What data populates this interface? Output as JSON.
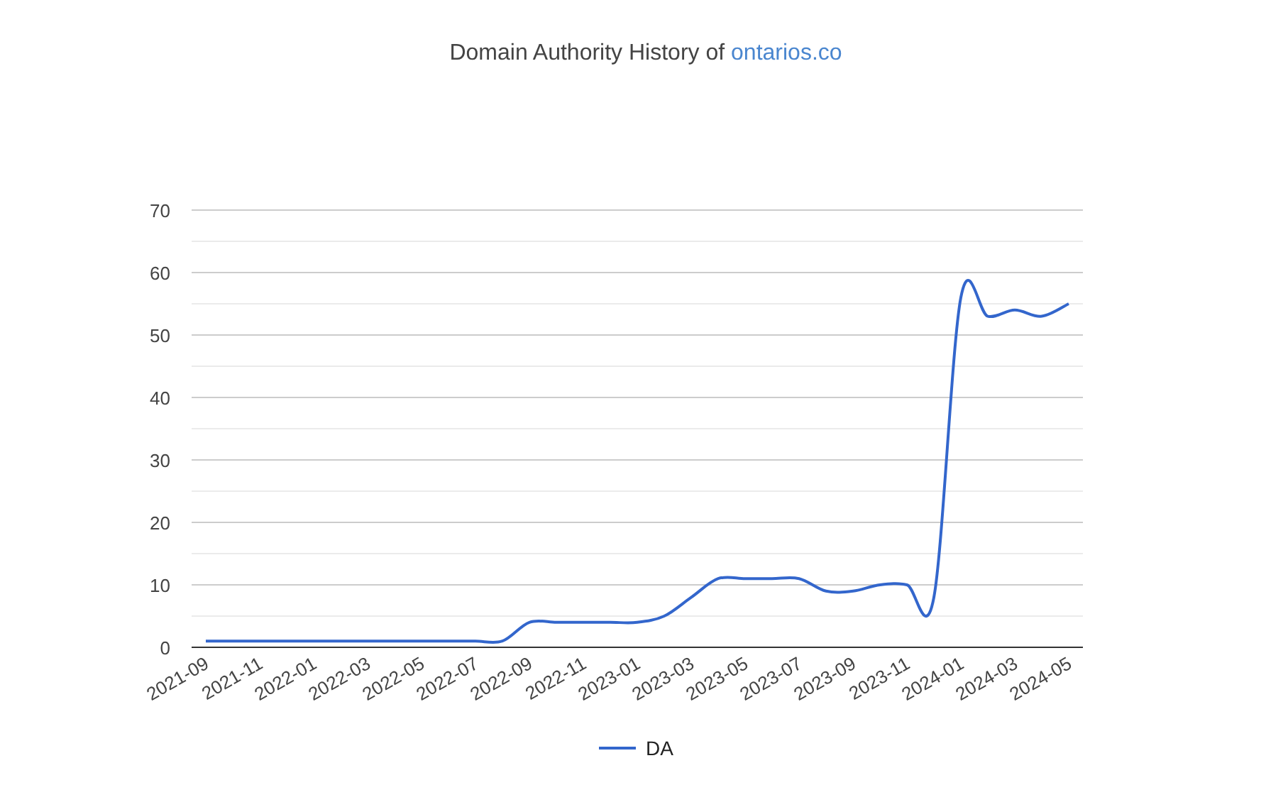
{
  "title": {
    "text": "Domain Authority History of",
    "link": "ontarios.co"
  },
  "chart_data": {
    "type": "line",
    "grid": true,
    "categories": [
      "2021-09",
      null,
      "2021-11",
      null,
      "2022-01",
      null,
      "2022-03",
      null,
      "2022-05",
      null,
      "2022-07",
      null,
      "2022-09",
      null,
      "2022-11",
      null,
      "2023-01",
      null,
      "2023-03",
      null,
      "2023-05",
      null,
      "2023-07",
      null,
      "2023-09",
      null,
      "2023-11",
      null,
      "2024-01",
      null,
      "2024-03",
      null,
      "2024-05"
    ],
    "series": [
      {
        "name": "DA",
        "color": "#3366cc",
        "values": [
          1,
          1,
          1,
          1,
          1,
          1,
          1,
          1,
          1,
          1,
          1,
          1,
          4,
          4,
          4,
          4,
          4,
          5,
          8,
          11,
          11,
          11,
          11,
          9,
          9,
          10,
          10,
          8,
          56,
          53,
          54,
          53,
          55
        ]
      }
    ],
    "ylim": [
      0,
      70
    ],
    "yticks": [
      0,
      10,
      20,
      30,
      40,
      50,
      60,
      70
    ]
  }
}
